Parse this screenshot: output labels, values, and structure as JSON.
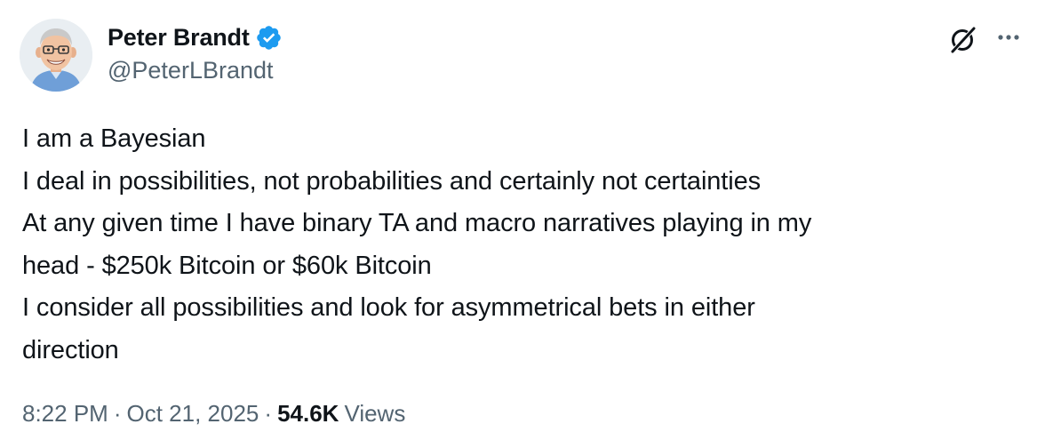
{
  "author": {
    "display_name": "Peter Brandt",
    "handle": "@PeterLBrandt",
    "verified": true,
    "verified_color": "#1d9bf0"
  },
  "actions": {
    "grok_icon": "grok-icon",
    "more_icon": "more-icon"
  },
  "tweet": {
    "lines": [
      "I am a Bayesian",
      "I deal in possibilities, not probabilities and certainly not certainties",
      "At any given time I have binary TA and macro narratives playing in my",
      "head - $250k Bitcoin or $60k Bitcoin",
      "I consider all possibilities and look for asymmetrical bets in either",
      "direction"
    ]
  },
  "meta": {
    "time": "8:22 PM",
    "separator": "·",
    "date": "Oct 21, 2025",
    "views_count": "54.6K",
    "views_label": "Views"
  },
  "colors": {
    "text_primary": "#0f1419",
    "text_secondary": "#536471",
    "accent": "#1d9bf0"
  }
}
